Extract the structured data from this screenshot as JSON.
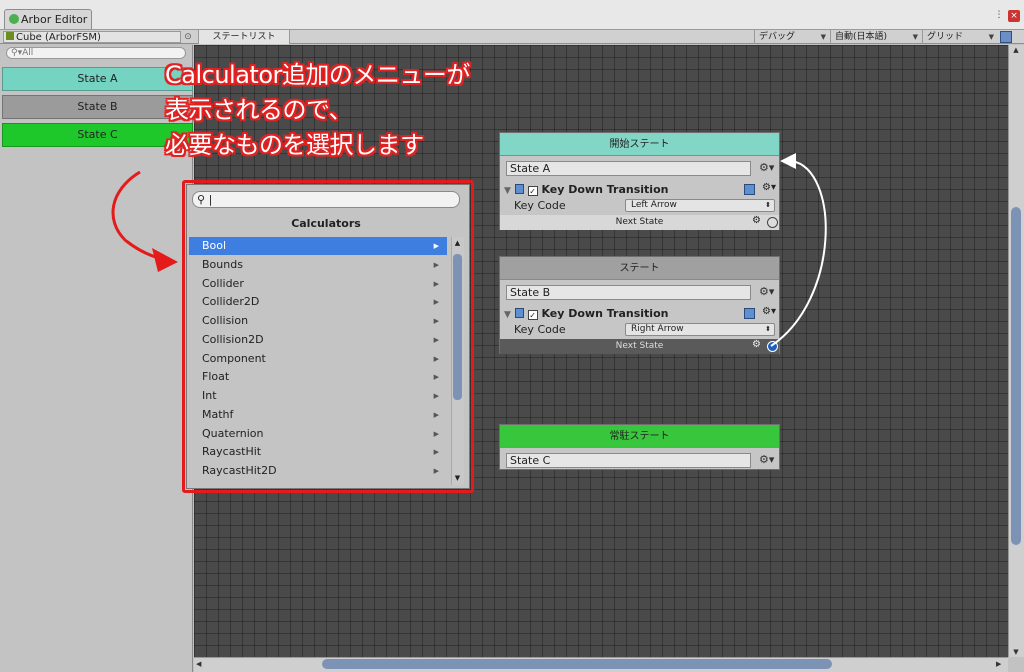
{
  "window": {
    "tab_title": "Arbor Editor",
    "menu_icon": "menu-icon",
    "close_icon": "close-icon"
  },
  "toolbar": {
    "fsm_selector": "Cube (ArborFSM)",
    "state_list_tab": "ステートリスト",
    "debug_dropdown": "デバッグ",
    "auto_dropdown": "自動(日本語)",
    "grid_dropdown": "グリッド"
  },
  "sidebar": {
    "search_placeholder": "All",
    "states": [
      {
        "label": "State A",
        "color": "#74d3c1"
      },
      {
        "label": "State B",
        "color": "#9b9b9b"
      },
      {
        "label": "State C",
        "color": "#1fc82a"
      }
    ]
  },
  "nodes": {
    "state_a": {
      "header": "開始ステート",
      "name": "State A",
      "header_color": "#82d6c6",
      "transition": {
        "title": "Key Down Transition",
        "key_label": "Key Code",
        "key_value": "Left Arrow",
        "next_label": "Next State"
      }
    },
    "state_b": {
      "header": "ステート",
      "name": "State B",
      "header_color": "#a0a0a0",
      "transition": {
        "title": "Key Down Transition",
        "key_label": "Key Code",
        "key_value": "Right Arrow",
        "next_label": "Next State"
      }
    },
    "state_c": {
      "header": "常駐ステート",
      "name": "State C",
      "header_color": "#38c63c"
    }
  },
  "calculator_popup": {
    "search_value": "",
    "title": "Calculators",
    "items": [
      {
        "label": "Bool",
        "selected": true
      },
      {
        "label": "Bounds"
      },
      {
        "label": "Collider"
      },
      {
        "label": "Collider2D"
      },
      {
        "label": "Collision"
      },
      {
        "label": "Collision2D"
      },
      {
        "label": "Component"
      },
      {
        "label": "Float"
      },
      {
        "label": "Int"
      },
      {
        "label": "Mathf"
      },
      {
        "label": "Quaternion"
      },
      {
        "label": "RaycastHit"
      },
      {
        "label": "RaycastHit2D"
      }
    ],
    "selected_color": "#3d7ee0"
  },
  "annotation": {
    "lines": [
      "Calculator追加のメニューが",
      "表示されるので、",
      "必要なものを選択します"
    ],
    "color": "#e12222"
  }
}
